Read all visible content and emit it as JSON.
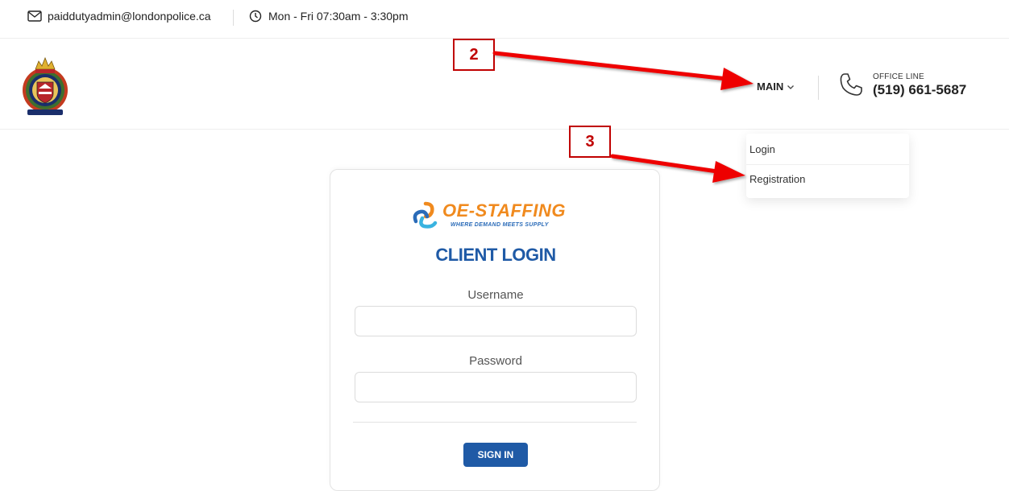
{
  "topbar": {
    "email": "paiddutyadmin@londonpolice.ca",
    "hours": "Mon - Fri 07:30am - 3:30pm",
    "icons": [
      "envelope-icon",
      "clock-icon"
    ]
  },
  "header": {
    "menu_label": "MAIN",
    "office_label": "OFFICE LINE",
    "office_number": "(519) 661-5687",
    "icons": [
      "police-crest-logo",
      "chevron-down-icon",
      "phone-icon"
    ]
  },
  "dropdown": {
    "items": [
      {
        "label": "Login"
      },
      {
        "label": "Registration"
      }
    ]
  },
  "login": {
    "brand": "OE-STAFFING",
    "tagline": "WHERE DEMAND MEETS SUPPLY",
    "title": "CLIENT LOGIN",
    "username_label": "Username",
    "password_label": "Password",
    "username_value": "",
    "password_value": "",
    "signin_label": "SIGN IN"
  },
  "annotations": {
    "callouts": [
      "2",
      "3"
    ],
    "color": "#c00000",
    "arrow_color": "#ee0000"
  },
  "colors": {
    "accent_blue": "#1f5aa6",
    "brand_orange": "#f08a1e"
  }
}
